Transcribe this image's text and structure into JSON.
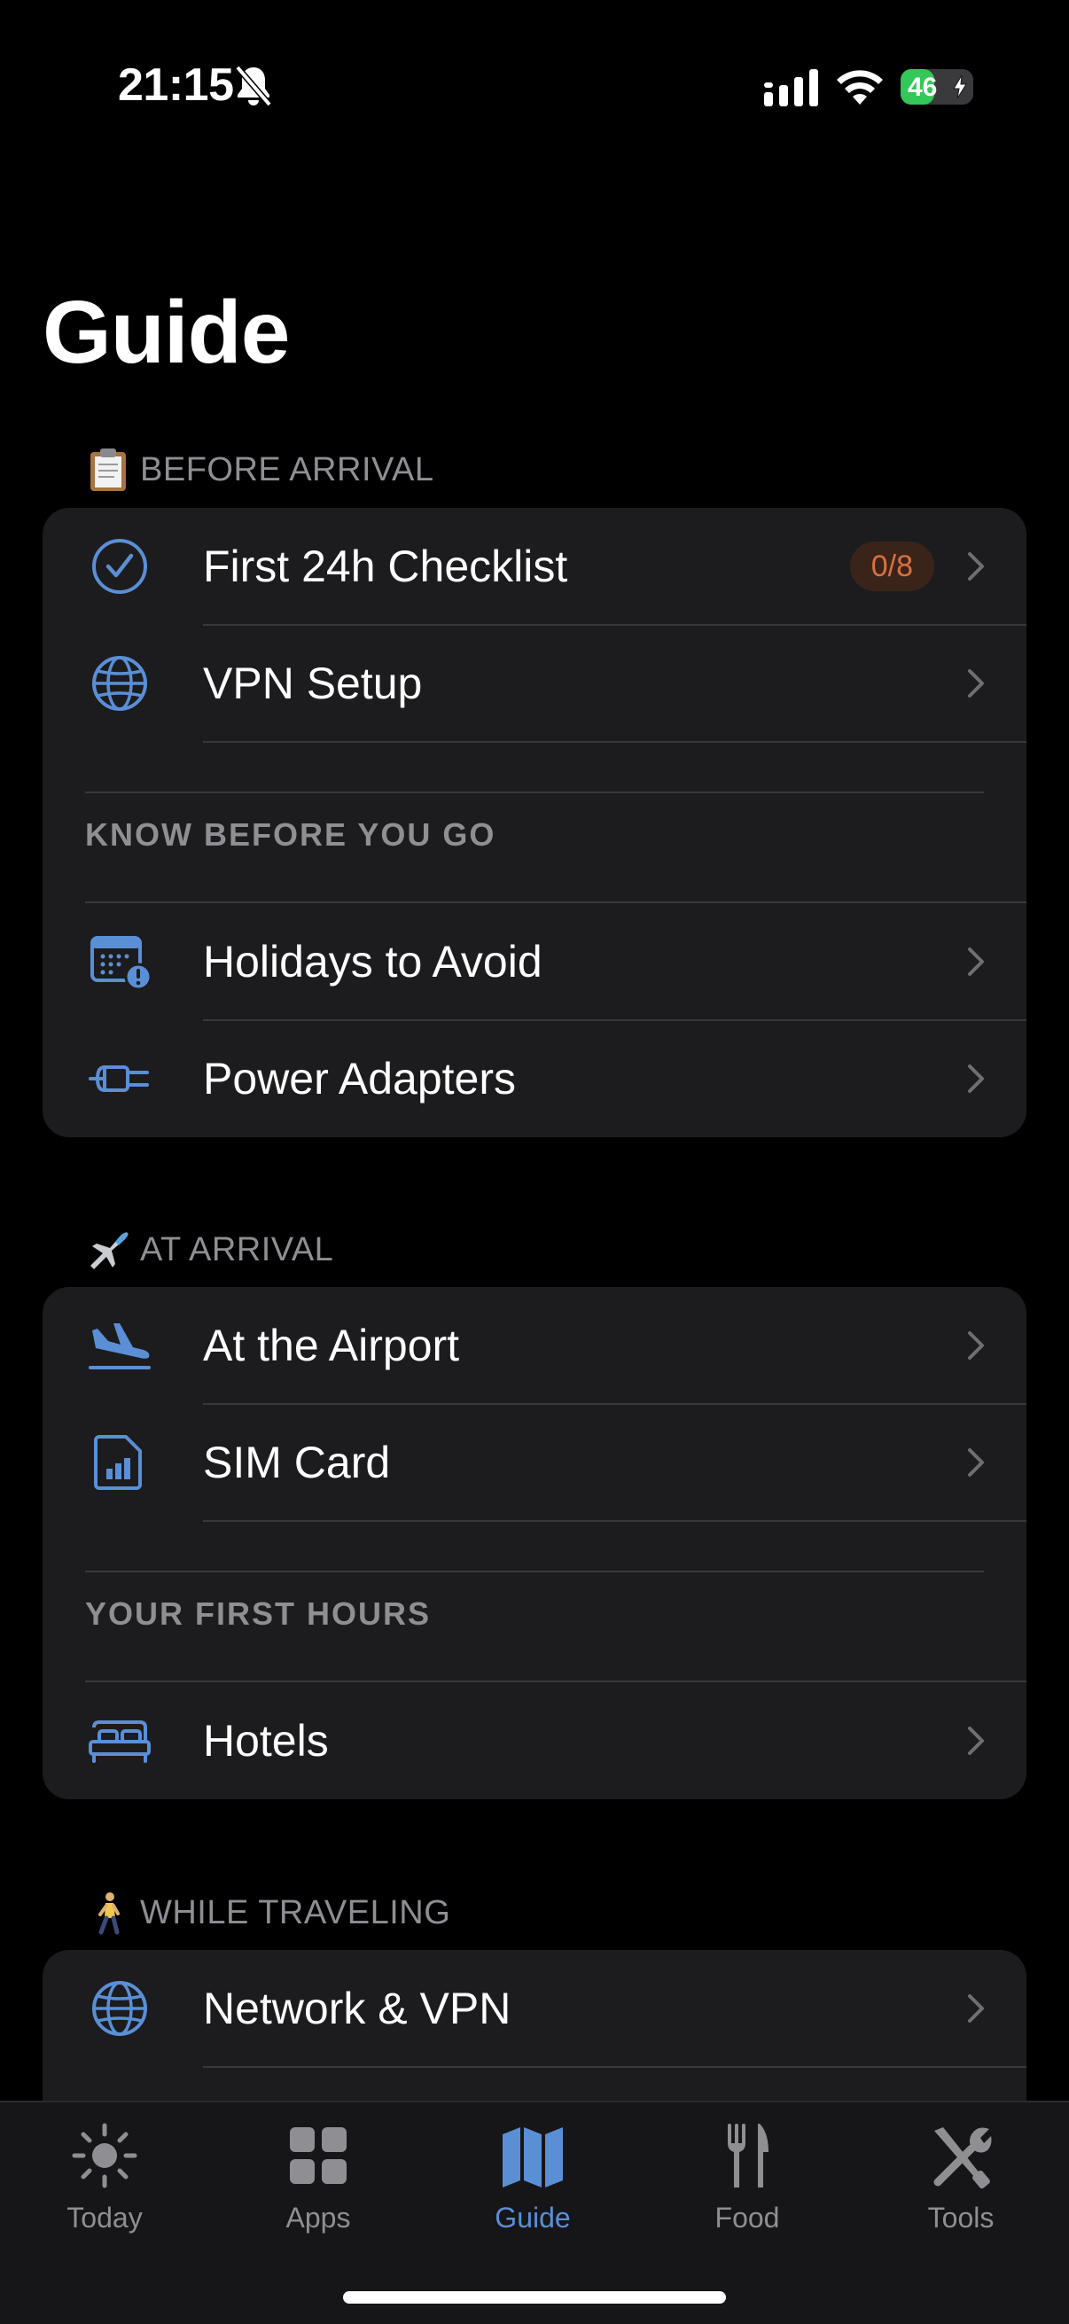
{
  "status_bar": {
    "time": "21:15",
    "battery": "46",
    "battery_level": 0.46
  },
  "page_title": "Guide",
  "sections": {
    "before_arrival": {
      "label": "BEFORE ARRIVAL",
      "emoji": "clipboard-icon",
      "items": [
        {
          "label": "First 24h Checklist",
          "icon": "checkmark-circle-icon",
          "badge": "0/8"
        },
        {
          "label": "VPN Setup",
          "icon": "globe-icon"
        }
      ],
      "subheader": "KNOW BEFORE YOU GO",
      "sub_items": [
        {
          "label": "Holidays to Avoid",
          "icon": "calendar-alert-icon"
        },
        {
          "label": "Power Adapters",
          "icon": "plug-icon"
        }
      ]
    },
    "at_arrival": {
      "label": "AT ARRIVAL",
      "emoji": "airplane-icon",
      "items": [
        {
          "label": "At the Airport",
          "icon": "airplane-landing-icon"
        },
        {
          "label": "SIM Card",
          "icon": "sim-card-icon"
        }
      ],
      "subheader": "YOUR FIRST HOURS",
      "sub_items": [
        {
          "label": "Hotels",
          "icon": "bed-icon"
        }
      ]
    },
    "while_traveling": {
      "label": "WHILE TRAVELING",
      "emoji": "walking-person-icon",
      "items": [
        {
          "label": "Network & VPN",
          "icon": "globe-icon"
        }
      ]
    }
  },
  "tab_bar": {
    "tabs": [
      {
        "label": "Today",
        "icon": "sun-icon"
      },
      {
        "label": "Apps",
        "icon": "apps-grid-icon"
      },
      {
        "label": "Guide",
        "icon": "map-icon",
        "active": true
      },
      {
        "label": "Food",
        "icon": "fork-knife-icon"
      },
      {
        "label": "Tools",
        "icon": "tools-icon"
      }
    ]
  },
  "colors": {
    "accent": "#5a8fd6",
    "card": "#1c1c1e",
    "badge_text": "#d9703f",
    "secondary_text": "#8e8e93"
  }
}
